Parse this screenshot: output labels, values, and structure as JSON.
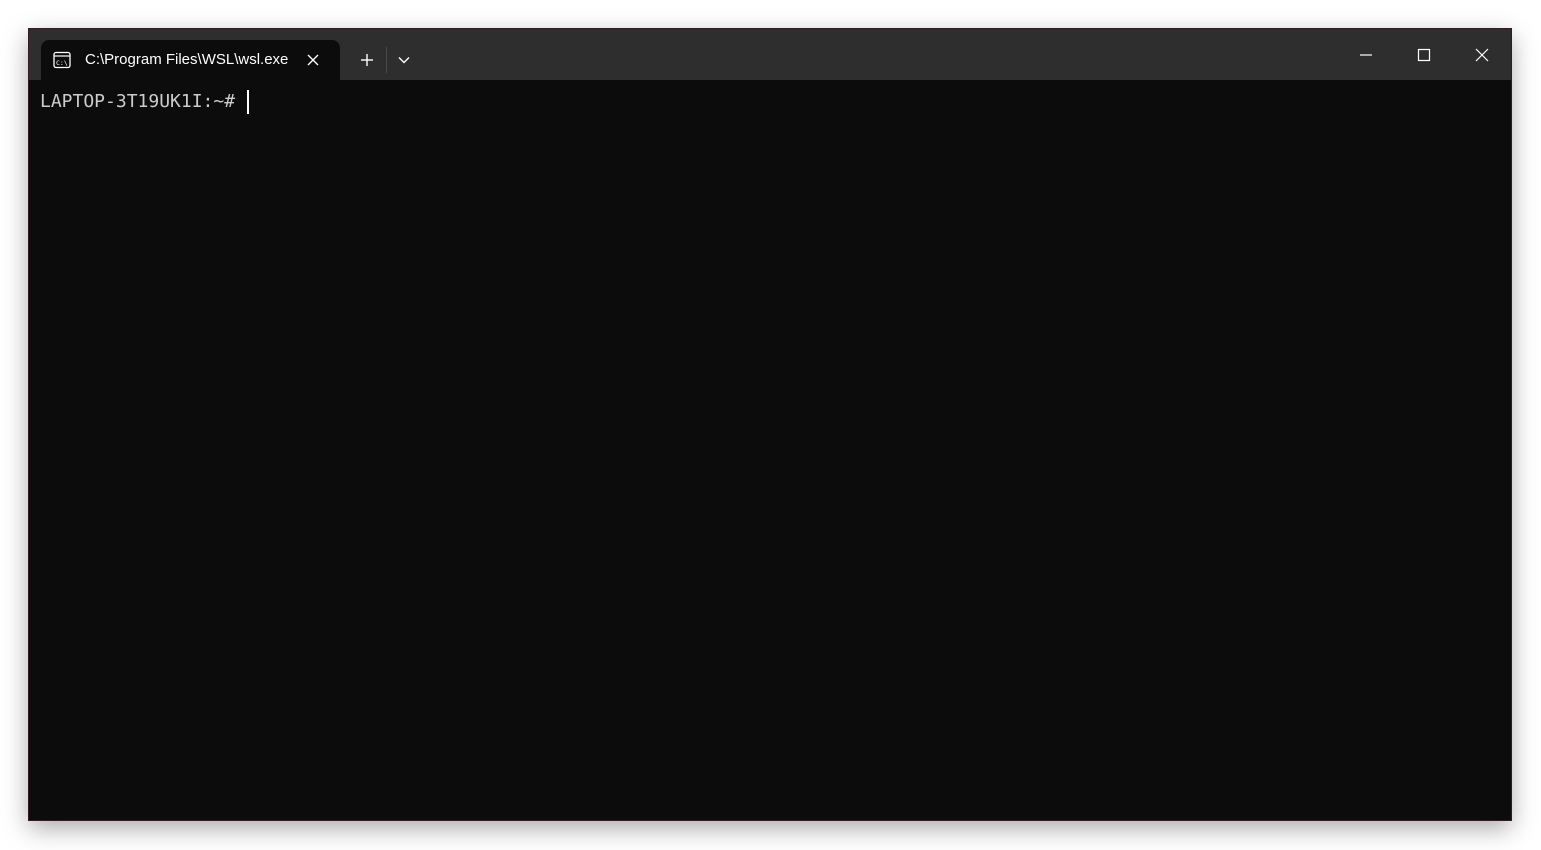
{
  "window": {
    "tab_title": "C:\\Program Files\\WSL\\wsl.exe",
    "tab_icon": "terminal-cmd-icon",
    "close_tab_icon": "close-icon",
    "new_tab_icon": "plus-icon",
    "dropdown_icon": "chevron-down-icon",
    "minimize_icon": "minimize-icon",
    "maximize_icon": "maximize-icon",
    "close_window_icon": "close-icon"
  },
  "terminal": {
    "prompt": "LAPTOP-3T19UK1I:~#"
  },
  "colors": {
    "titlebar": "#2e2e2e",
    "terminal_bg": "#0c0c0c",
    "text": "#cccccc"
  }
}
